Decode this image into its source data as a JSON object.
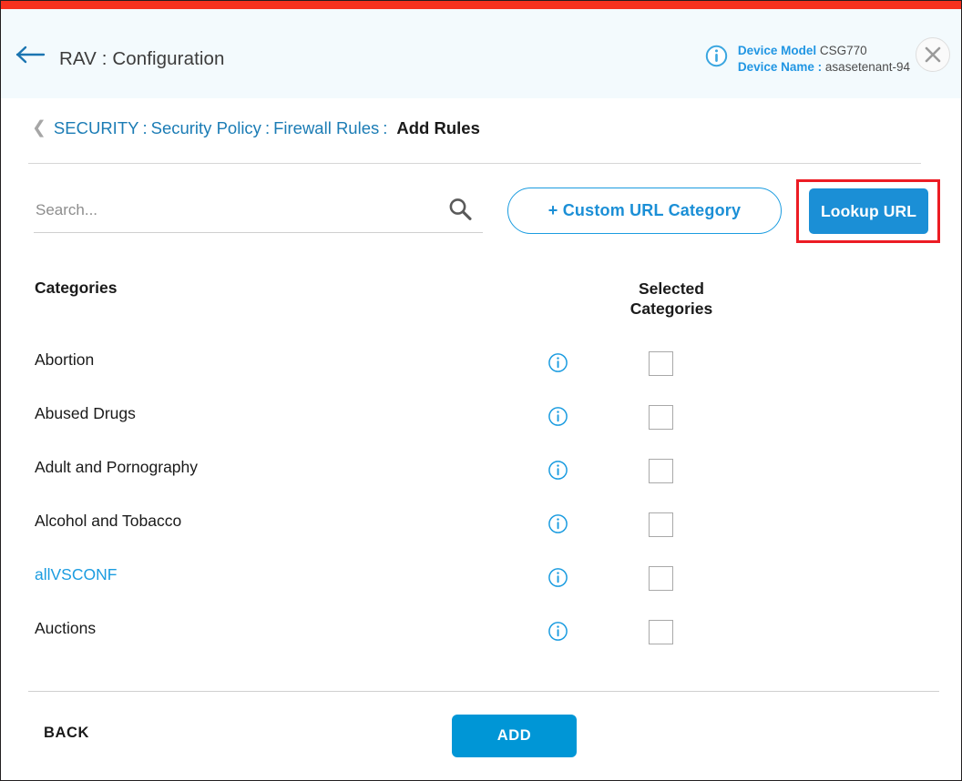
{
  "window": {
    "accent_bar_color": "#f5321e",
    "header_bg_color": "#f3fafd"
  },
  "header": {
    "back_arrow_icon": "arrow-left-icon",
    "title": "RAV : Configuration",
    "info_icon": "info-circle-icon",
    "device_model_label": "Device Model",
    "device_model_value": "CSG770",
    "device_name_label": "Device Name :",
    "device_name_value": "asasetenant-94",
    "close_icon": "close-icon",
    "link_color": "#2196e3"
  },
  "breadcrumb": {
    "chevron_icon": "chevron-left-icon",
    "items": [
      {
        "label": "SECURITY",
        "current": false
      },
      {
        "label": "Security Policy",
        "current": false
      },
      {
        "label": "Firewall Rules",
        "current": false
      },
      {
        "label": "Add Rules",
        "current": true
      }
    ],
    "separator": ":",
    "link_color": "#1b7cb5"
  },
  "toolbar": {
    "search_placeholder": "Search...",
    "search_value": "",
    "search_icon": "search-icon",
    "custom_url_label": "+ Custom URL Category",
    "lookup_url_label": "Lookup URL",
    "lookup_highlight_color": "#ec1c24",
    "primary_color": "#1b8fd6"
  },
  "table": {
    "headers": {
      "categories": "Categories",
      "selected_line1": "Selected",
      "selected_line2": "Categories"
    },
    "rows": [
      {
        "name": "Abortion",
        "custom": false,
        "checked": false,
        "info_icon": "info-circle-icon"
      },
      {
        "name": "Abused Drugs",
        "custom": false,
        "checked": false,
        "info_icon": "info-circle-icon"
      },
      {
        "name": "Adult and Pornography",
        "custom": false,
        "checked": false,
        "info_icon": "info-circle-icon"
      },
      {
        "name": "Alcohol and Tobacco",
        "custom": false,
        "checked": false,
        "info_icon": "info-circle-icon"
      },
      {
        "name": "allVSCONF",
        "custom": true,
        "checked": false,
        "info_icon": "info-circle-icon"
      },
      {
        "name": "Auctions",
        "custom": false,
        "checked": false,
        "info_icon": "info-circle-icon"
      }
    ],
    "custom_text_color": "#1b9ce0"
  },
  "footer": {
    "back_label": "BACK",
    "add_label": "ADD",
    "add_button_color": "#0096d6"
  }
}
